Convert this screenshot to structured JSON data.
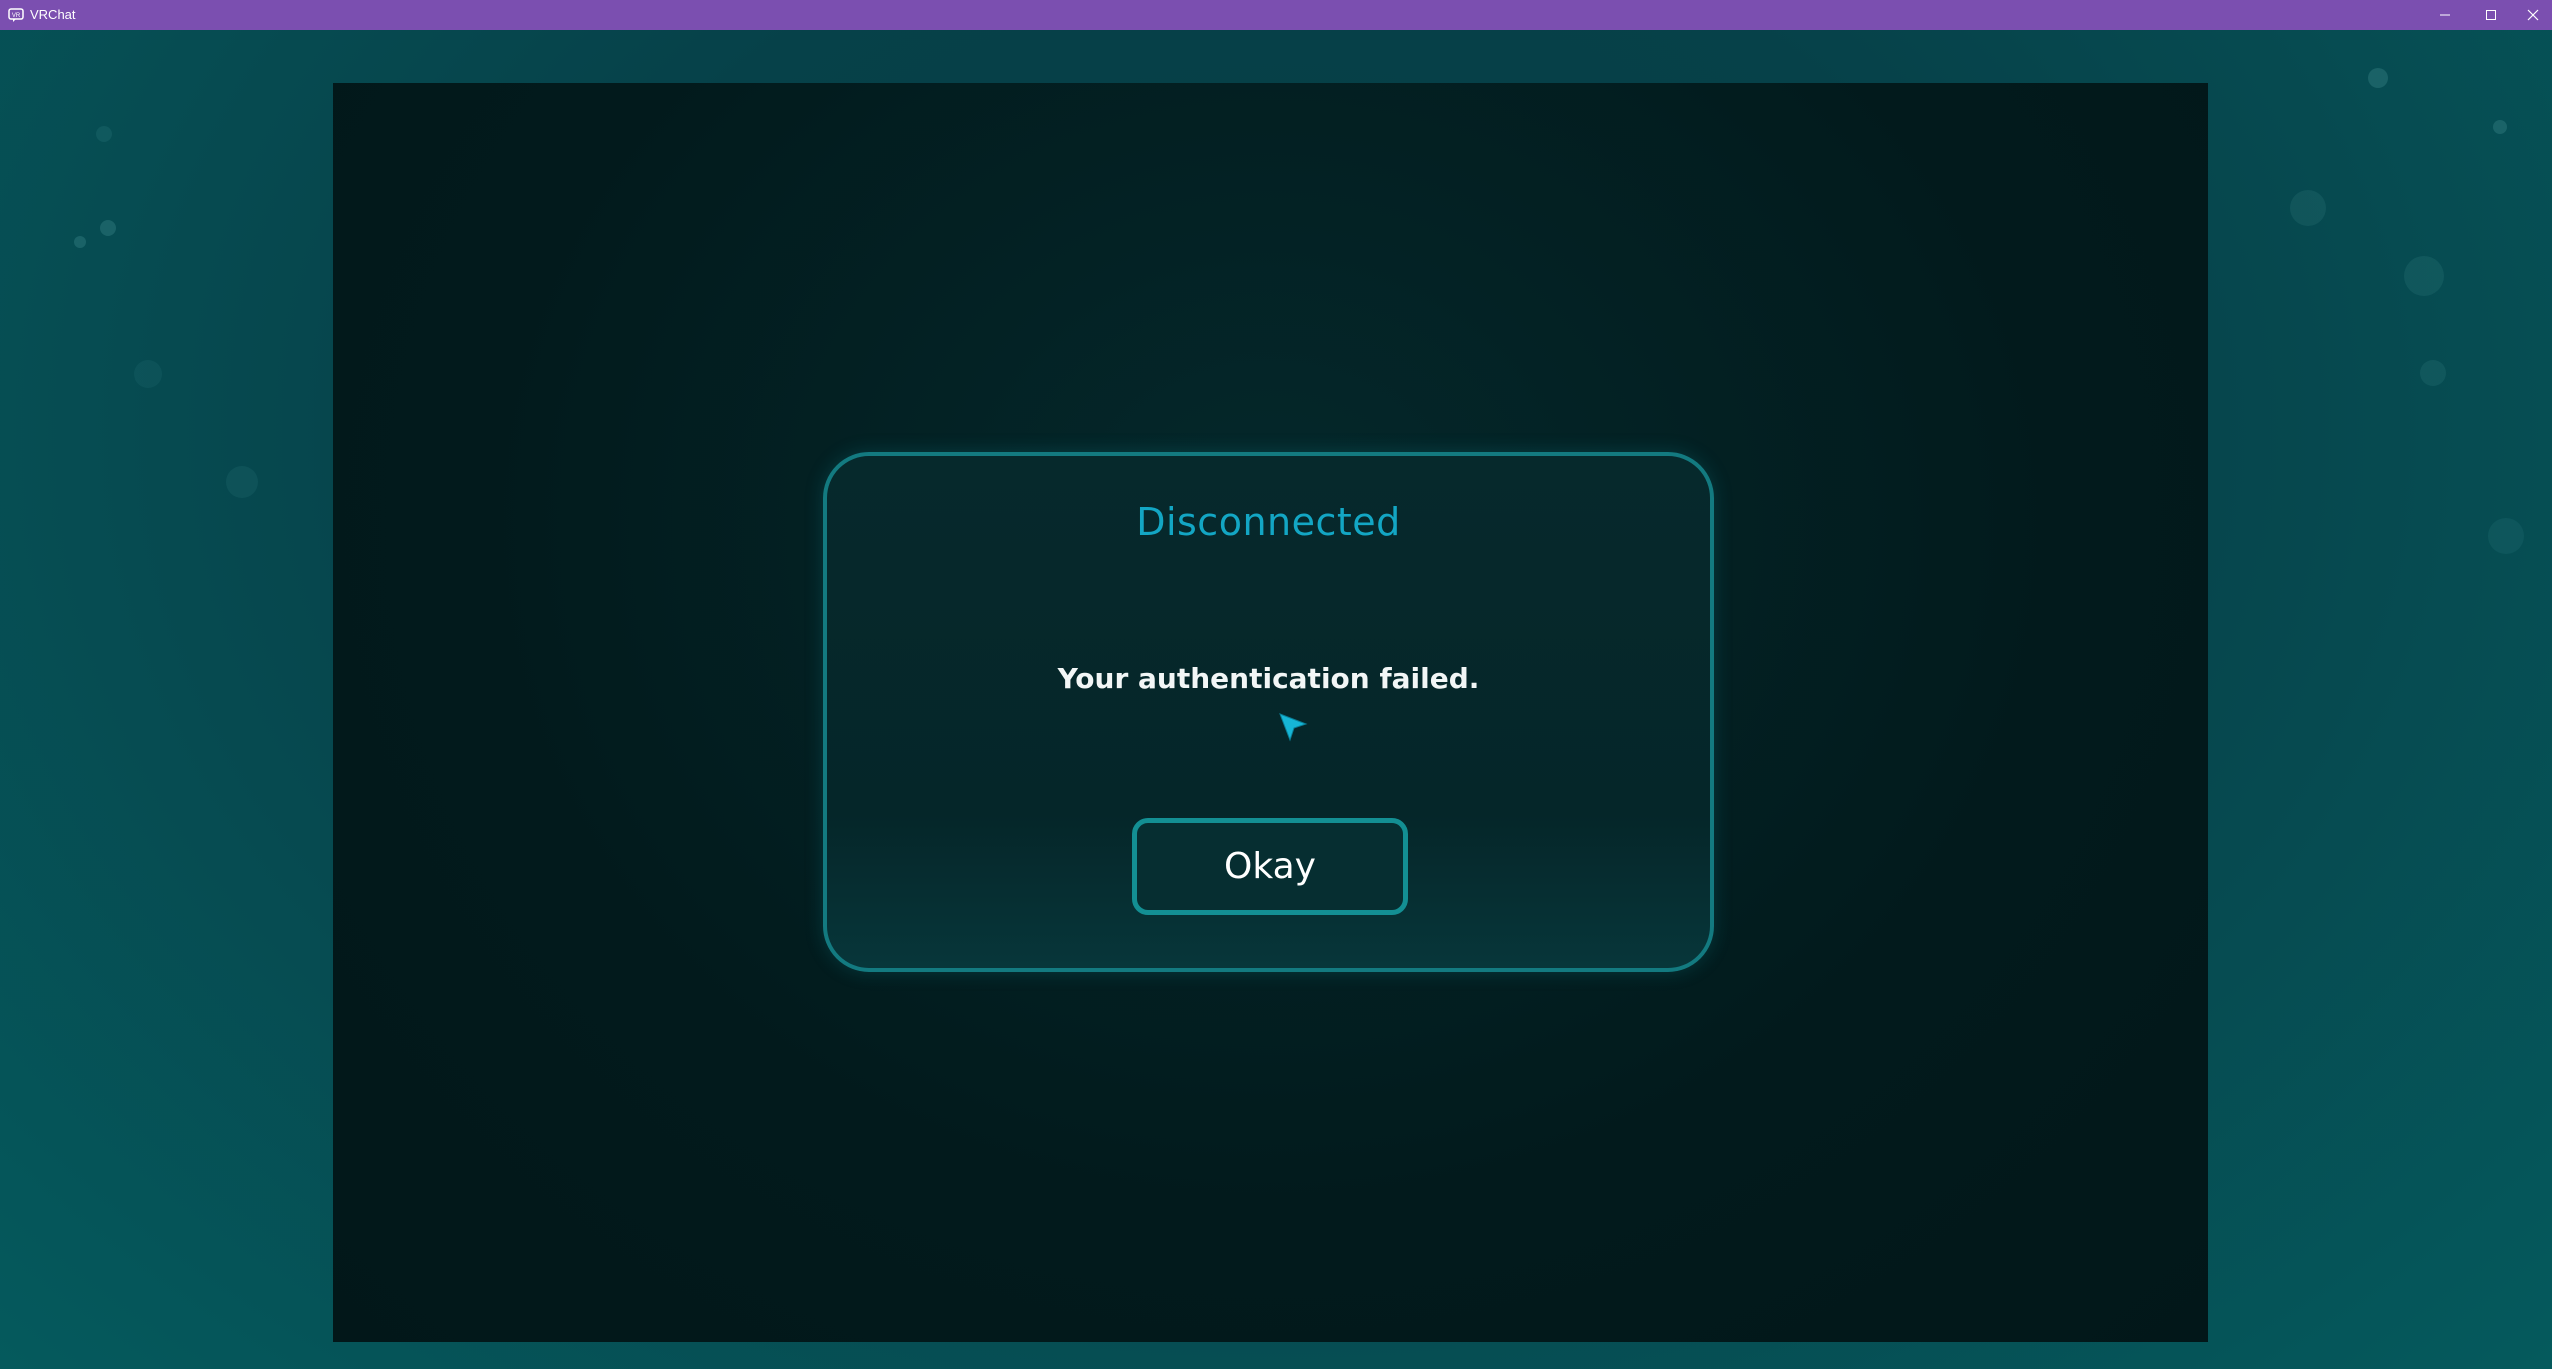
{
  "window": {
    "title": "VRChat",
    "icon": "vrchat-app-icon",
    "controls": {
      "minimize_icon": "minimize-icon",
      "maximize_icon": "maximize-icon",
      "close_icon": "close-icon"
    }
  },
  "dialog": {
    "title": "Disconnected",
    "message": "Your authentication failed.",
    "button_label": "Okay"
  },
  "colors": {
    "titlebar": "#7b4fb0",
    "accent": "#13a6c4",
    "border": "#137a80",
    "background": "#05343a"
  }
}
